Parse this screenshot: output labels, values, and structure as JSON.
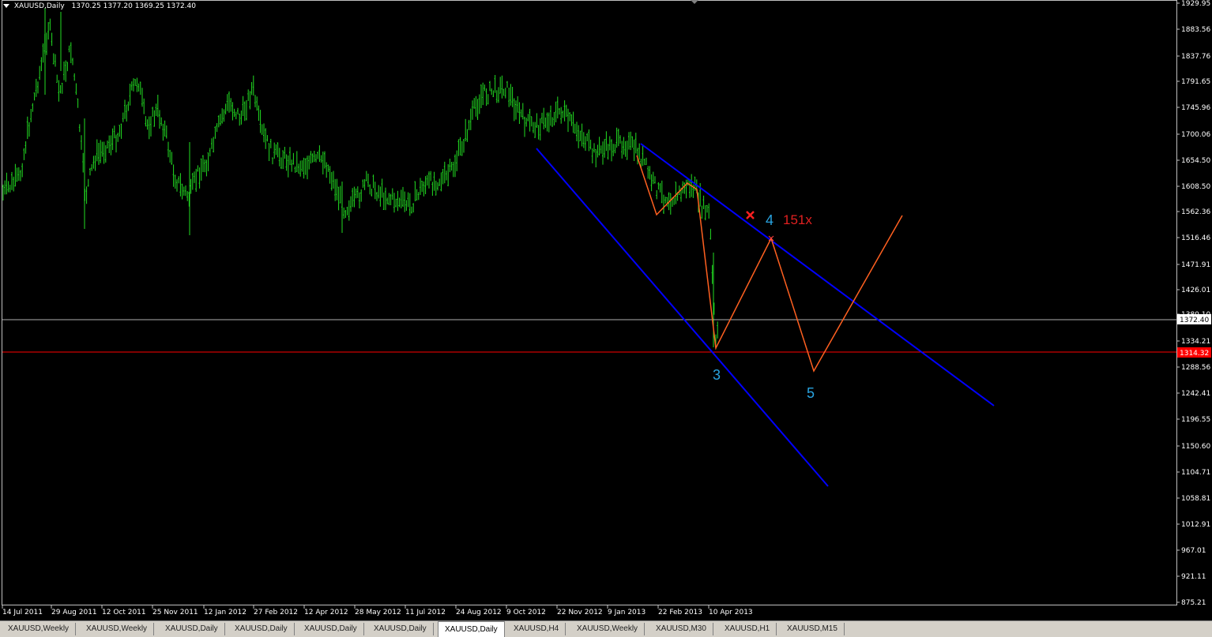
{
  "header": {
    "symbol": "XAUUSD,Daily",
    "ohlc": "1370.25 1377.20 1369.25 1372.40"
  },
  "price_axis": {
    "labels": [
      "1929.95",
      "1883.56",
      "1837.76",
      "1791.65",
      "1745.96",
      "1700.06",
      "1654.50",
      "1608.50",
      "1562.36",
      "1516.46",
      "1471.91",
      "1426.01",
      "1380.10",
      "1334.21",
      "1288.56",
      "1242.41",
      "1196.55",
      "1150.60",
      "1104.71",
      "1058.81",
      "1012.91",
      "967.01",
      "921.11",
      "875.21"
    ],
    "current_price": "1372.40",
    "line_price": "1314.32",
    "current_price_color": "#c0c0c0",
    "line_color": "#ff0000"
  },
  "time_axis": {
    "labels": [
      "14 Jul 2011",
      "29 Aug 2011",
      "12 Oct 2011",
      "25 Nov 2011",
      "12 Jan 2012",
      "27 Feb 2012",
      "12 Apr 2012",
      "28 May 2012",
      "11 Jul 2012",
      "24 Aug 2012",
      "9 Oct 2012",
      "22 Nov 2012",
      "9 Jan 2013",
      "22 Feb 2013",
      "10 Apr 2013"
    ]
  },
  "annotations": {
    "wave_3": "3",
    "wave_4": "4",
    "wave_5": "5",
    "ratio": "151x",
    "wave_color": "#29a3e0",
    "ratio_color": "#e02020",
    "channel_color": "#0000ff",
    "zigzag_color": "#ff6020",
    "bar_color": "#22dd22"
  },
  "tabs": [
    {
      "label": "XAUUSD,Weekly",
      "active": false
    },
    {
      "label": "XAUUSD,Weekly",
      "active": false
    },
    {
      "label": "XAUUSD,Daily",
      "active": false
    },
    {
      "label": "XAUUSD,Daily",
      "active": false
    },
    {
      "label": "XAUUSD,Daily",
      "active": false
    },
    {
      "label": "XAUUSD,Daily",
      "active": false
    },
    {
      "label": "XAUUSD,Daily",
      "active": true
    },
    {
      "label": "XAUUSD,H4",
      "active": false
    },
    {
      "label": "XAUUSD,Weekly",
      "active": false
    },
    {
      "label": "XAUUSD,M30",
      "active": false
    },
    {
      "label": "XAUUSD,H1",
      "active": false
    },
    {
      "label": "XAUUSD,M15",
      "active": false
    }
  ],
  "chart_data": {
    "type": "line",
    "title": "XAUUSD,Daily",
    "ylim": [
      875.21,
      1929.95
    ],
    "x": [
      "14 Jul 2011",
      "29 Aug 2011",
      "12 Oct 2011",
      "25 Nov 2011",
      "12 Jan 2012",
      "27 Feb 2012",
      "12 Apr 2012",
      "28 May 2012",
      "11 Jul 2012",
      "24 Aug 2012",
      "9 Oct 2012",
      "22 Nov 2012",
      "9 Jan 2013",
      "22 Feb 2013",
      "10 Apr 2013"
    ],
    "series": [
      {
        "values": [
          1590,
          1830,
          1650,
          1720,
          1640,
          1740,
          1660,
          1570,
          1590,
          1650,
          1780,
          1720,
          1690,
          1590,
          1370
        ]
      }
    ]
  }
}
